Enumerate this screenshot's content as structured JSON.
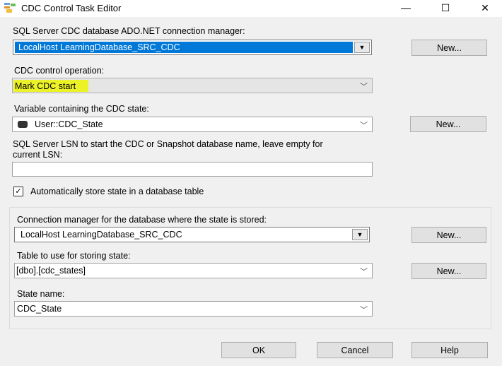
{
  "window": {
    "title": "CDC Control Task Editor",
    "minimize": "—",
    "maximize": "☐",
    "close": "✕"
  },
  "connection_manager": {
    "label": "SQL Server CDC database ADO.NET connection manager:",
    "value": "LocalHost LearningDatabase_SRC_CDC",
    "new_label": "New..."
  },
  "operation": {
    "label": "CDC control operation:",
    "value": "Mark CDC start",
    "highlight_color": "#ecf228"
  },
  "state_variable": {
    "label": "Variable containing the CDC state:",
    "value": "User::CDC_State",
    "new_label": "New..."
  },
  "lsn": {
    "label_line1": "SQL Server LSN to start the CDC or Snapshot database name, leave empty for",
    "label_line2": "current LSN:",
    "value": ""
  },
  "auto_store": {
    "label": "Automatically store state in a database table",
    "checked": true,
    "check_glyph": "✓"
  },
  "state_group": {
    "conn_label": "Connection manager for the database where the state is stored:",
    "conn_value": "LocalHost LearningDatabase_SRC_CDC",
    "conn_new": "New...",
    "table_label": "Table to use for storing state:",
    "table_value": "[dbo].[cdc_states]",
    "table_new": "New...",
    "state_name_label": "State name:",
    "state_name_value": "CDC_State"
  },
  "footer": {
    "ok": "OK",
    "cancel": "Cancel",
    "help": "Help"
  },
  "icons": {
    "dropdown_filled": "▼",
    "chevron": "﹀"
  }
}
